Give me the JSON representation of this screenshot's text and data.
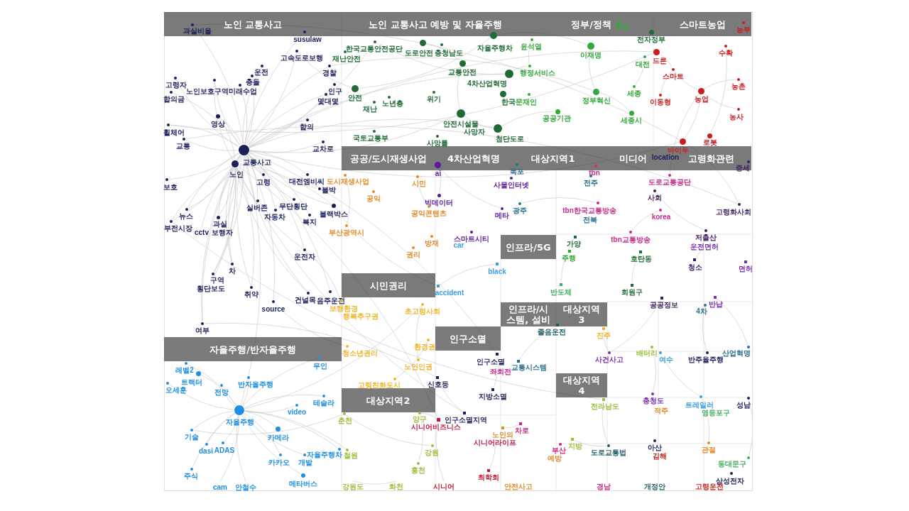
{
  "topics": [
    "노인 교통사고",
    "노인 교통사고 예방 및 자율주행",
    "정부/정책",
    "스마트농업",
    "공공/도시재생사업",
    "4차산업혁명",
    "대상지역1",
    "미디어",
    "고령화관련",
    "인프라/5G",
    "시민권리",
    "인프라/시스템, 설비",
    "대상지역3",
    "인구소멸",
    "자율주행/반자율주행",
    "대상지역4",
    "대상지역2"
  ],
  "nodes": [
    {
      "label": "과실비율",
      "color": "#1b1f5c",
      "kind": "circle"
    },
    {
      "label": "susulaw",
      "color": "#1b1f5c",
      "kind": "circle"
    },
    {
      "label": "고속도로보행",
      "color": "#1b1f5c",
      "kind": "circle"
    },
    {
      "label": "운전",
      "color": "#1b1f5c",
      "kind": "circle"
    },
    {
      "label": "충돌",
      "color": "#1b1f5c",
      "kind": "circle"
    },
    {
      "label": "노인보호구역",
      "color": "#1b1f5c",
      "kind": "circle"
    },
    {
      "label": "미래수업",
      "color": "#1b1f5c",
      "kind": "circle"
    },
    {
      "label": "고령자",
      "color": "#1b1f5c",
      "kind": "circle"
    },
    {
      "label": "합의금",
      "color": "#1b1f5c",
      "kind": "circle"
    },
    {
      "label": "경찰",
      "color": "#1b1f5c",
      "kind": "circle"
    },
    {
      "label": "인구",
      "color": "#1b1f5c",
      "kind": "circle"
    },
    {
      "label": "몇대몇",
      "color": "#1b1f5c",
      "kind": "circle"
    },
    {
      "label": "영상",
      "color": "#1b1f5c",
      "kind": "circle"
    },
    {
      "label": "합의",
      "color": "#1b1f5c",
      "kind": "circle"
    },
    {
      "label": "휠체어",
      "color": "#1b1f5c",
      "kind": "circle"
    },
    {
      "label": "교통",
      "color": "#1b1f5c",
      "kind": "circle"
    },
    {
      "label": "교차로",
      "color": "#1b1f5c",
      "kind": "circle"
    },
    {
      "label": "교통사고",
      "color": "#1b1f5c",
      "kind": "circle"
    },
    {
      "label": "노인",
      "color": "#1b1f5c",
      "kind": "circle"
    },
    {
      "label": "보호",
      "color": "#1b1f5c",
      "kind": "circle"
    },
    {
      "label": "고령",
      "color": "#1b1f5c",
      "kind": "circle"
    },
    {
      "label": "대전엠비씨",
      "color": "#1b1f5c",
      "kind": "circle"
    },
    {
      "label": "블박",
      "color": "#1b1f5c",
      "kind": "circle"
    },
    {
      "label": "실버존",
      "color": "#1b1f5c",
      "kind": "circle"
    },
    {
      "label": "무단횡단",
      "color": "#1b1f5c",
      "kind": "circle"
    },
    {
      "label": "자동차",
      "color": "#1b1f5c",
      "kind": "circle"
    },
    {
      "label": "블랙박스",
      "color": "#1b1f5c",
      "kind": "circle"
    },
    {
      "label": "복지",
      "color": "#1b1f5c",
      "kind": "circle"
    },
    {
      "label": "뉴스",
      "color": "#1b1f5c",
      "kind": "circle"
    },
    {
      "label": "부전시장",
      "color": "#1b1f5c",
      "kind": "circle"
    },
    {
      "label": "과실",
      "color": "#1b1f5c",
      "kind": "circle"
    },
    {
      "label": "cctv",
      "color": "#1b1f5c",
      "kind": "text"
    },
    {
      "label": "보행자",
      "color": "#1b1f5c",
      "kind": "text"
    },
    {
      "label": "운전자",
      "color": "#1b1f5c",
      "kind": "circle"
    },
    {
      "label": "차",
      "color": "#1b1f5c",
      "kind": "circle"
    },
    {
      "label": "구역",
      "color": "#1b1f5c",
      "kind": "circle"
    },
    {
      "label": "횡단보도",
      "color": "#1b1f5c",
      "kind": "text"
    },
    {
      "label": "취약",
      "color": "#1b1f5c",
      "kind": "circle"
    },
    {
      "label": "source",
      "color": "#1b1f5c",
      "kind": "circle"
    },
    {
      "label": "건널목",
      "color": "#1b1f5c",
      "kind": "circle"
    },
    {
      "label": "음주운전",
      "color": "#1b1f5c",
      "kind": "circle"
    },
    {
      "label": "여부",
      "color": "#1b1f5c",
      "kind": "circle"
    },
    {
      "label": "레벨2",
      "color": "#1f8fe2",
      "kind": "circle"
    },
    {
      "label": "무인",
      "color": "#1f8fe2",
      "kind": "circle"
    },
    {
      "label": "트랙터",
      "color": "#1f8fe2",
      "kind": "circle"
    },
    {
      "label": "오세훈",
      "color": "#1f8fe2",
      "kind": "circle"
    },
    {
      "label": "반자율주행",
      "color": "#1f8fe2",
      "kind": "circle"
    },
    {
      "label": "전망",
      "color": "#1f8fe2",
      "kind": "circle"
    },
    {
      "label": "자율주행",
      "color": "#1f8fe2",
      "kind": "circle"
    },
    {
      "label": "video",
      "color": "#1f8fe2",
      "kind": "circle"
    },
    {
      "label": "테슬라",
      "color": "#1f8fe2",
      "kind": "circle"
    },
    {
      "label": "기술",
      "color": "#1f8fe2",
      "kind": "circle"
    },
    {
      "label": "카메라",
      "color": "#1f8fe2",
      "kind": "circle"
    },
    {
      "label": "dasi",
      "color": "#1f8fe2",
      "kind": "circle"
    },
    {
      "label": "ADAS",
      "color": "#1f8fe2",
      "kind": "circle"
    },
    {
      "label": "주식",
      "color": "#1f8fe2",
      "kind": "circle"
    },
    {
      "label": "카카오",
      "color": "#1f8fe2",
      "kind": "circle"
    },
    {
      "label": "개발",
      "color": "#1f8fe2",
      "kind": "circle"
    },
    {
      "label": "자율주행차",
      "color": "#1f8fe2",
      "kind": "circle"
    },
    {
      "label": "메타버스",
      "color": "#1f8fe2",
      "kind": "circle"
    },
    {
      "label": "cam",
      "color": "#1f8fe2",
      "kind": "text"
    },
    {
      "label": "안철수",
      "color": "#1f8fe2",
      "kind": "text"
    },
    {
      "label": "한국교통안전공단",
      "color": "#1f6b36",
      "kind": "circle"
    },
    {
      "label": "재난안전",
      "color": "#1f6b36",
      "kind": "circle"
    },
    {
      "label": "도로안전",
      "color": "#1f6b36",
      "kind": "circle"
    },
    {
      "label": "충청남도",
      "color": "#1f6b36",
      "kind": "circle"
    },
    {
      "label": "자율주행차",
      "color": "#1f6b36",
      "kind": "circle"
    },
    {
      "label": "교통안전",
      "color": "#1f6b36",
      "kind": "circle"
    },
    {
      "label": "4차산업혁명",
      "color": "#1f6b36",
      "kind": "circle"
    },
    {
      "label": "안전",
      "color": "#1f6b36",
      "kind": "circle"
    },
    {
      "label": "재난",
      "color": "#1f6b36",
      "kind": "circle"
    },
    {
      "label": "노년층",
      "color": "#1f6b36",
      "kind": "circle"
    },
    {
      "label": "위기",
      "color": "#1f6b36",
      "kind": "circle"
    },
    {
      "label": "한국",
      "color": "#1f6b36",
      "kind": "circle"
    },
    {
      "label": "안전시설물",
      "color": "#1f6b36",
      "kind": "circle"
    },
    {
      "label": "사망자",
      "color": "#1f6b36",
      "kind": "text"
    },
    {
      "label": "첨단도로",
      "color": "#1f6b36",
      "kind": "circle"
    },
    {
      "label": "국토교통부",
      "color": "#1f6b36",
      "kind": "circle"
    },
    {
      "label": "사망률",
      "color": "#1f6b36",
      "kind": "circle"
    },
    {
      "label": "문재인",
      "color": "#33a83a",
      "kind": "circle"
    },
    {
      "label": "윤석열",
      "color": "#33a83a",
      "kind": "circle"
    },
    {
      "label": "충남",
      "color": "#33a83a",
      "kind": "circle"
    },
    {
      "label": "전자정부",
      "color": "#1f6b36",
      "kind": "circle"
    },
    {
      "label": "이재명",
      "color": "#33a83a",
      "kind": "circle"
    },
    {
      "label": "대전",
      "color": "#33a83a",
      "kind": "circle"
    },
    {
      "label": "행정서비스",
      "color": "#33a83a",
      "kind": "circle"
    },
    {
      "label": "정부혁신",
      "color": "#33a83a",
      "kind": "circle"
    },
    {
      "label": "세종",
      "color": "#33a83a",
      "kind": "circle"
    },
    {
      "label": "공공기관",
      "color": "#33a83a",
      "kind": "circle"
    },
    {
      "label": "세종시",
      "color": "#33a83a",
      "kind": "circle"
    },
    {
      "label": "농부",
      "color": "#c81e1e",
      "kind": "circle"
    },
    {
      "label": "드론",
      "color": "#c81e1e",
      "kind": "circle"
    },
    {
      "label": "수확",
      "color": "#c81e1e",
      "kind": "circle"
    },
    {
      "label": "스마트",
      "color": "#c81e1e",
      "kind": "circle"
    },
    {
      "label": "농촌",
      "color": "#c81e1e",
      "kind": "circle"
    },
    {
      "label": "농업",
      "color": "#c81e1e",
      "kind": "circle"
    },
    {
      "label": "이동형",
      "color": "#c81e1e",
      "kind": "circle"
    },
    {
      "label": "농사",
      "color": "#c81e1e",
      "kind": "circle"
    },
    {
      "label": "로봇",
      "color": "#c81e1e",
      "kind": "circle"
    },
    {
      "label": "바이두",
      "color": "#c81e1e",
      "kind": "circle"
    },
    {
      "label": "location",
      "color": "#1b1f5c",
      "kind": "text"
    },
    {
      "label": "도시재생사업",
      "color": "#e38b2c",
      "kind": "circle"
    },
    {
      "label": "시민",
      "color": "#e38b2c",
      "kind": "circle"
    },
    {
      "label": "공익",
      "color": "#e38b2c",
      "kind": "circle"
    },
    {
      "label": "공익콘텐츠",
      "color": "#e38b2c",
      "kind": "circle"
    },
    {
      "label": "부산광역시",
      "color": "#e38b2c",
      "kind": "circle"
    },
    {
      "label": "방재",
      "color": "#e38b2c",
      "kind": "circle"
    },
    {
      "label": "권리",
      "color": "#e38b2c",
      "kind": "circle"
    },
    {
      "label": "ai",
      "color": "#5a1a9a",
      "kind": "circle"
    },
    {
      "label": "빅데이터",
      "color": "#5a1a9a",
      "kind": "circle"
    },
    {
      "label": "사물인터넷",
      "color": "#5a1a9a",
      "kind": "circle"
    },
    {
      "label": "메타",
      "color": "#5a1a9a",
      "kind": "circle"
    },
    {
      "label": "스마트시티",
      "color": "#5a1a9a",
      "kind": "circle"
    },
    {
      "label": "car",
      "color": "#3a9ee0",
      "kind": "text"
    },
    {
      "label": "목포",
      "color": "#2a6f8e",
      "kind": "circle"
    },
    {
      "label": "tbn",
      "color": "#c92a8a",
      "kind": "circle"
    },
    {
      "label": "전주",
      "color": "#2a6f8e",
      "kind": "circle"
    },
    {
      "label": "도로교통공단",
      "color": "#c92a8a",
      "kind": "circle"
    },
    {
      "label": "광주",
      "color": "#2a6f8e",
      "kind": "circle"
    },
    {
      "label": "tbn한국교통방송",
      "color": "#c92a8a",
      "kind": "circle"
    },
    {
      "label": "전북",
      "color": "#2a6f8e",
      "kind": "text"
    },
    {
      "label": "korea",
      "color": "#c92a8a",
      "kind": "circle"
    },
    {
      "label": "tbn교통방송",
      "color": "#c92a8a",
      "kind": "circle"
    },
    {
      "label": "사회",
      "color": "#3b1b5c",
      "kind": "circle"
    },
    {
      "label": "고령화사회",
      "color": "#3b1b5c",
      "kind": "circle"
    },
    {
      "label": "저출산",
      "color": "#3b1b5c",
      "kind": "circle"
    },
    {
      "label": "운전면허",
      "color": "#7a2db0",
      "kind": "text"
    },
    {
      "label": "증세",
      "color": "#3b1b5c",
      "kind": "circle"
    },
    {
      "label": "청소",
      "color": "#3b1b5c",
      "kind": "square"
    },
    {
      "label": "면허",
      "color": "#7a2db0",
      "kind": "square"
    },
    {
      "label": "가양",
      "color": "#1f6b36",
      "kind": "square"
    },
    {
      "label": "주행",
      "color": "#33a83a",
      "kind": "square"
    },
    {
      "label": "호탄동",
      "color": "#1f6b36",
      "kind": "square"
    },
    {
      "label": "반도체",
      "color": "#3fae5e",
      "kind": "square"
    },
    {
      "label": "회원구",
      "color": "#1f6b36",
      "kind": "square"
    },
    {
      "label": "black",
      "color": "#3a9ee0",
      "kind": "square"
    },
    {
      "label": "accident",
      "color": "#3a9ee0",
      "kind": "square"
    },
    {
      "label": "보행환경",
      "color": "#eeb52a",
      "kind": "circle"
    },
    {
      "label": "행복추구권",
      "color": "#eeb52a",
      "kind": "text"
    },
    {
      "label": "초고령사회",
      "color": "#eeb52a",
      "kind": "circle"
    },
    {
      "label": "환경권",
      "color": "#eeb52a",
      "kind": "circle"
    },
    {
      "label": "청소년권리",
      "color": "#eeb52a",
      "kind": "circle"
    },
    {
      "label": "노인인권",
      "color": "#eeb52a",
      "kind": "circle"
    },
    {
      "label": "고령친화도시",
      "color": "#eeb52a",
      "kind": "circle"
    },
    {
      "label": "춘천",
      "color": "#9cbf3a",
      "kind": "circle"
    },
    {
      "label": "양구",
      "color": "#9cbf3a",
      "kind": "circle"
    },
    {
      "label": "철원",
      "color": "#9cbf3a",
      "kind": "circle"
    },
    {
      "label": "강원",
      "color": "#9cbf3a",
      "kind": "circle"
    },
    {
      "label": "홍천",
      "color": "#9cbf3a",
      "kind": "circle"
    },
    {
      "label": "강원도",
      "color": "#9cbf3a",
      "kind": "text"
    },
    {
      "label": "화천",
      "color": "#9cbf3a",
      "kind": "text"
    },
    {
      "label": "시니어비즈니스",
      "color": "#c0183c",
      "kind": "square"
    },
    {
      "label": "시니어라이프",
      "color": "#c0183c",
      "kind": "text"
    },
    {
      "label": "최학회",
      "color": "#c0183c",
      "kind": "square"
    },
    {
      "label": "시니어",
      "color": "#c0183c",
      "kind": "text"
    },
    {
      "label": "인구소멸",
      "color": "#1b1f5c",
      "kind": "square"
    },
    {
      "label": "신호등",
      "color": "#1b1f5c",
      "kind": "square"
    },
    {
      "label": "지방소멸",
      "color": "#1b1f5c",
      "kind": "square"
    },
    {
      "label": "인구소멸지역",
      "color": "#1b1f5c",
      "kind": "square"
    },
    {
      "label": "노인의",
      "color": "#e38b2c",
      "kind": "square"
    },
    {
      "label": "차로",
      "color": "#c92a8a",
      "kind": "square"
    },
    {
      "label": "안전사고",
      "color": "#e38b2c",
      "kind": "text"
    },
    {
      "label": "예방",
      "color": "#e38b2c",
      "kind": "text"
    },
    {
      "label": "부산",
      "color": "#c92a8a",
      "kind": "circle"
    },
    {
      "label": "좌회전",
      "color": "#c92a8a",
      "kind": "text"
    },
    {
      "label": "교통시스템",
      "color": "#2a6f8e",
      "kind": "square"
    },
    {
      "label": "졸음운전",
      "color": "#1e5d66",
      "kind": "square"
    },
    {
      "label": "진주",
      "color": "#eeb52a",
      "kind": "square"
    },
    {
      "label": "공공정보",
      "color": "#3b1b5c",
      "kind": "square"
    },
    {
      "label": "반납",
      "color": "#7a2db0",
      "kind": "square"
    },
    {
      "label": "4차",
      "color": "#2a6f8e",
      "kind": "circle"
    },
    {
      "label": "사건사고",
      "color": "#7a2db0",
      "kind": "circle"
    },
    {
      "label": "배터리",
      "color": "#9cbf3a",
      "kind": "circle"
    },
    {
      "label": "여수",
      "color": "#3a9ee0",
      "kind": "circle"
    },
    {
      "label": "반주율주행",
      "color": "#1b1f5c",
      "kind": "circle"
    },
    {
      "label": "산업혁명",
      "color": "#2a6f8e",
      "kind": "circle"
    },
    {
      "label": "전라남도",
      "color": "#9cbf3a",
      "kind": "square"
    },
    {
      "label": "충청도",
      "color": "#7a2db0",
      "kind": "circle"
    },
    {
      "label": "적주",
      "color": "#e38b2c",
      "kind": "text"
    },
    {
      "label": "트레일러",
      "color": "#3a9ee0",
      "kind": "circle"
    },
    {
      "label": "영등포구",
      "color": "#3fae5e",
      "kind": "text"
    },
    {
      "label": "성남",
      "color": "#1b1f5c",
      "kind": "circle"
    },
    {
      "label": "지방",
      "color": "#9cbf3a",
      "kind": "square"
    },
    {
      "label": "도로교통법",
      "color": "#1e5d66",
      "kind": "circle"
    },
    {
      "label": "아산",
      "color": "#1b1f5c",
      "kind": "circle"
    },
    {
      "label": "김해",
      "color": "#c81e1e",
      "kind": "text"
    },
    {
      "label": "관절",
      "color": "#e38b2c",
      "kind": "circle"
    },
    {
      "label": "동대문구",
      "color": "#3fae5e",
      "kind": "circle"
    },
    {
      "label": "삼성전자",
      "color": "#1b1f5c",
      "kind": "circle"
    },
    {
      "label": "경남",
      "color": "#c92a8a",
      "kind": "text"
    },
    {
      "label": "개정안",
      "color": "#1e5d66",
      "kind": "text"
    },
    {
      "label": "고령운전",
      "color": "#c81e1e",
      "kind": "text"
    }
  ]
}
